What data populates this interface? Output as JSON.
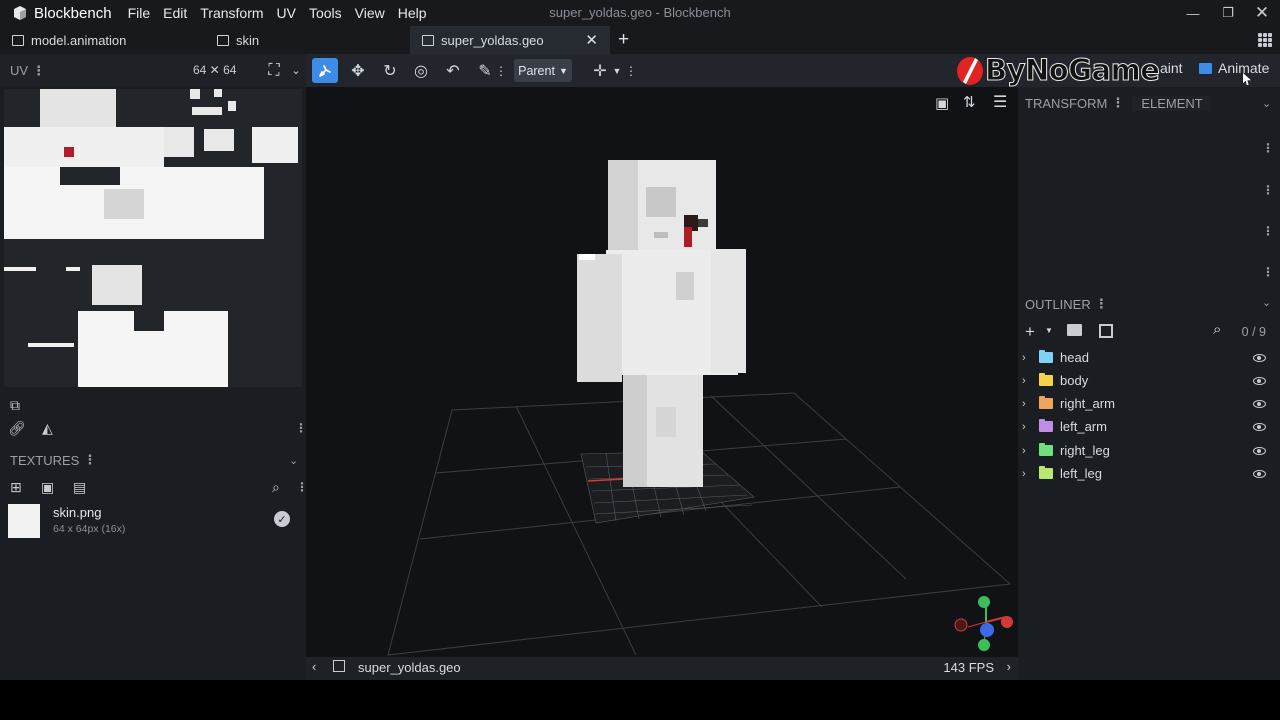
{
  "app": {
    "name": "Blockbench",
    "window_title": "super_yoldas.geo - Blockbench",
    "menu": [
      "File",
      "Edit",
      "Transform",
      "UV",
      "Tools",
      "View",
      "Help"
    ]
  },
  "tabs": [
    {
      "label": "model.animation"
    },
    {
      "label": "skin"
    },
    {
      "label": "super_yoldas.geo",
      "active": true
    }
  ],
  "toolbar": {
    "uv_label": "UV",
    "uv_size": "64 ✕ 64",
    "pivot_mode": "Parent",
    "modes": {
      "paint": "aint",
      "animate": "Animate"
    }
  },
  "watermark": {
    "text": "ByNoGame"
  },
  "textures": {
    "title": "TEXTURES",
    "items": [
      {
        "name": "skin.png",
        "meta": "64 x 64px (16x)"
      }
    ]
  },
  "viewport": {
    "file": "super_yoldas.geo",
    "fps": "143 FPS"
  },
  "right": {
    "tab_transform": "TRANSFORM",
    "tab_element": "ELEMENT",
    "outliner_title": "OUTLINER",
    "outliner_count": "0 / 9",
    "groups": [
      {
        "name": "head",
        "color": "#7dd3f5"
      },
      {
        "name": "body",
        "color": "#f5d24a"
      },
      {
        "name": "right_arm",
        "color": "#f0a55c"
      },
      {
        "name": "left_arm",
        "color": "#c08ce8"
      },
      {
        "name": "right_leg",
        "color": "#6fe07b"
      },
      {
        "name": "left_leg",
        "color": "#b9e872"
      }
    ]
  },
  "colors": {
    "accent": "#3d8ce8",
    "viewport_bg": "#111215",
    "panel_bg": "#1a1d21"
  }
}
